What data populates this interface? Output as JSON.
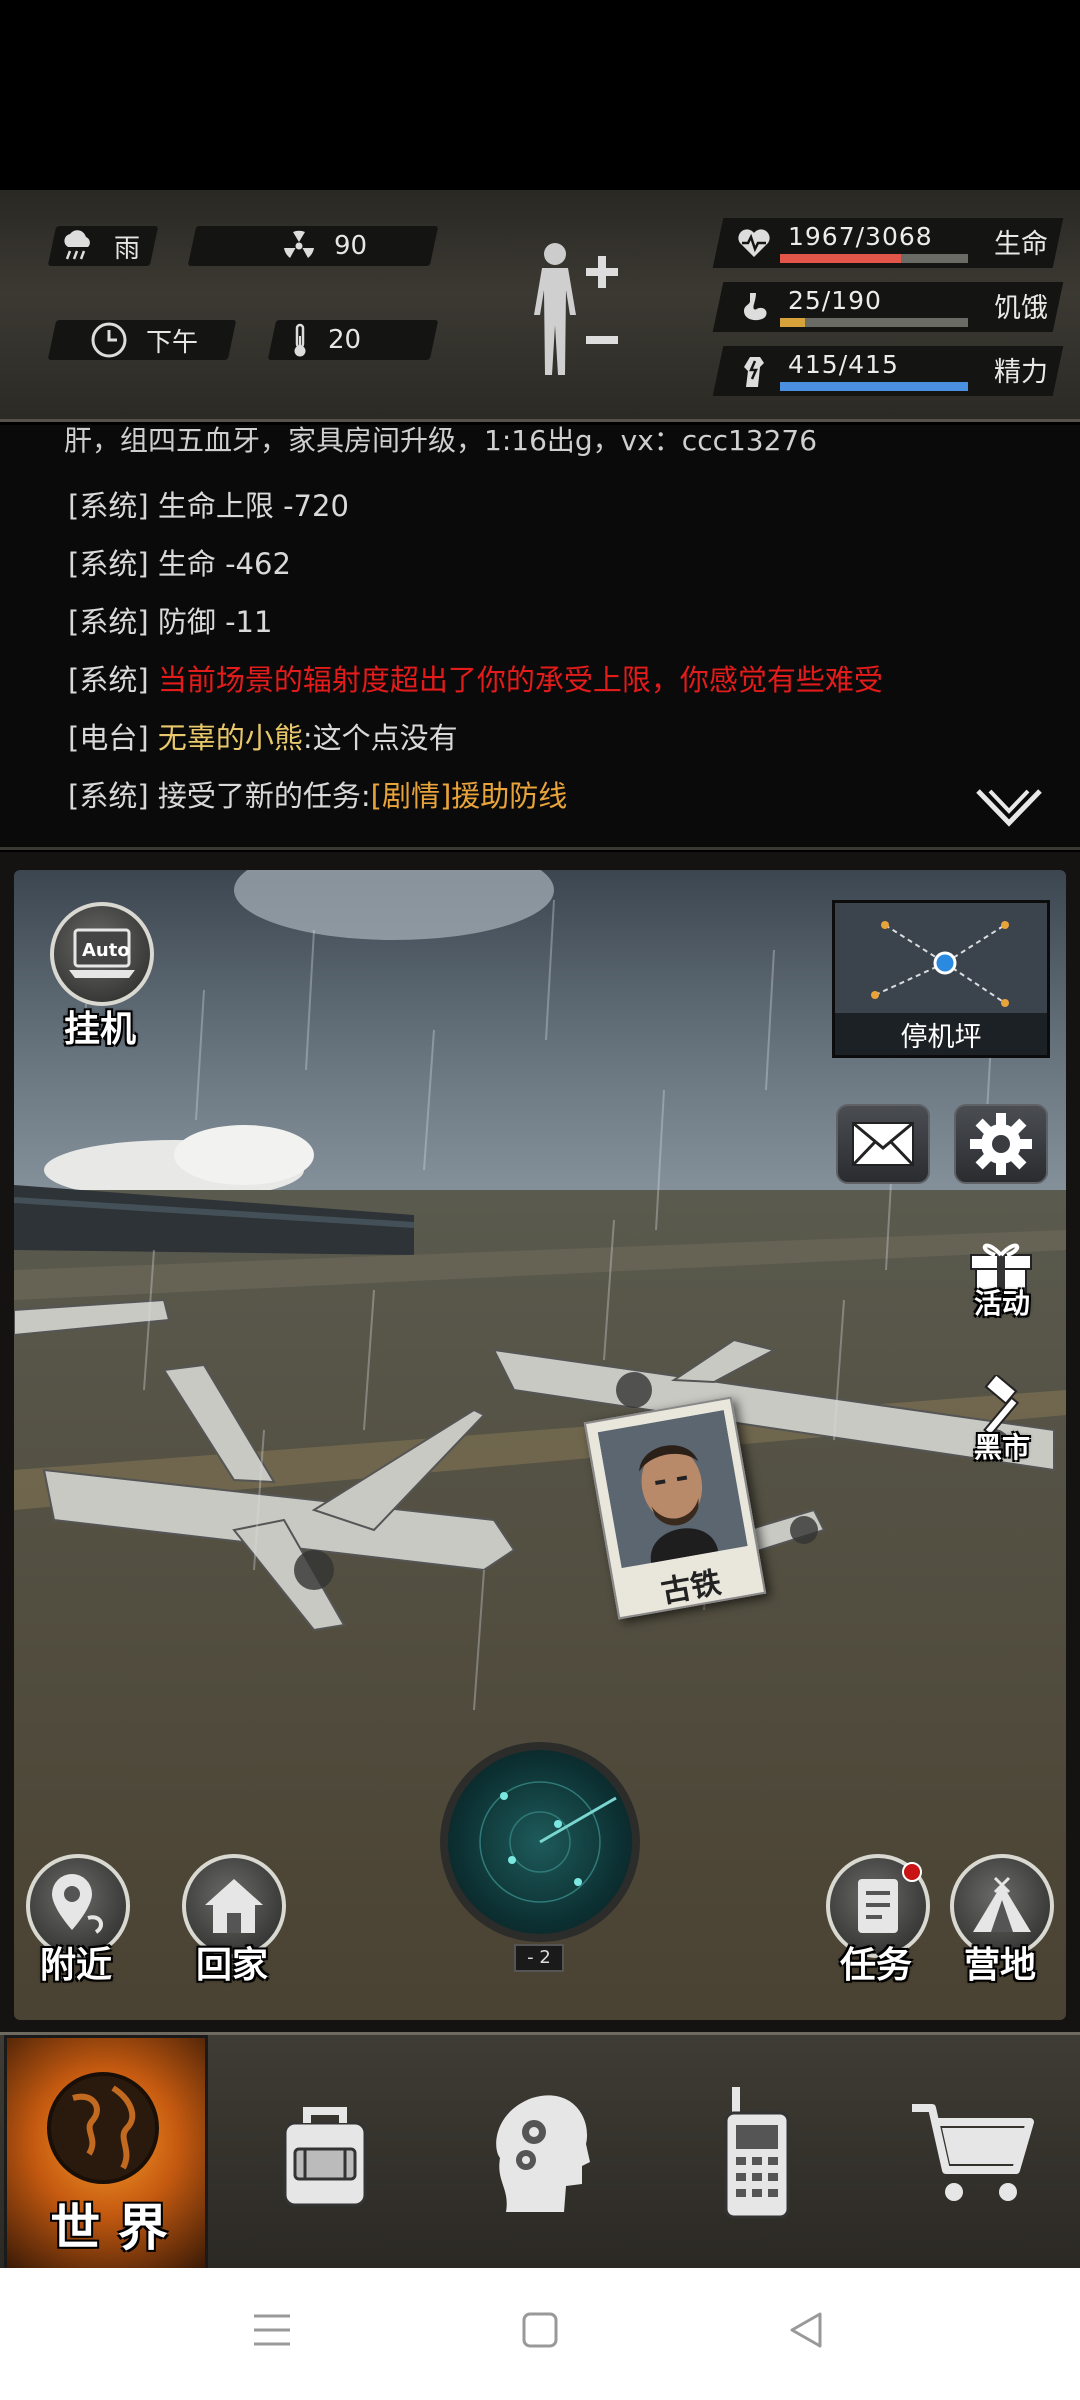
{
  "status": {
    "weather": "雨",
    "radiation": "90",
    "time_of_day": "下午",
    "temperature": "20",
    "health": {
      "text": "1967/3068",
      "label": "生命",
      "fraction": 0.641,
      "color": "#e2564a"
    },
    "hunger": {
      "text": "25/190",
      "label": "饥饿",
      "fraction": 0.132,
      "color": "#d7a23a"
    },
    "energy": {
      "text": "415/415",
      "label": "精力",
      "fraction": 1.0,
      "color": "#4a8fe0"
    }
  },
  "log": {
    "lines": [
      {
        "tag": "",
        "text": "肝，组四五血牙，家具房间升级，1:16出g，vx：ccc13276",
        "extra": ""
      },
      {
        "tag": "[系统]",
        "text": "生命上限 -720",
        "extra": ""
      },
      {
        "tag": "[系统]",
        "text": "生命 -462",
        "extra": ""
      },
      {
        "tag": "[系统]",
        "text": "防御 -11",
        "extra": ""
      },
      {
        "tag": "[系统]",
        "text": "当前场景的辐射度超出了你的承受上限，你感觉有些难受",
        "extra": ""
      },
      {
        "tag": "[电台]",
        "text": "无辜的小熊",
        "extra": ":这个点没有"
      },
      {
        "tag": "[系统]",
        "text": "接受了新的任务:",
        "extra": "[剧情]援助防线"
      }
    ]
  },
  "scene": {
    "auto_button_text": "Auto",
    "auto_label": "挂机",
    "location_name": "停机坪",
    "activity_label": "活动",
    "black_market_label": "黑市",
    "npc_name": "古铁",
    "radar_level": "- 2",
    "nearby_label": "附近",
    "home_label": "回家",
    "quest_label": "任务",
    "camp_label": "营地"
  },
  "nav": {
    "world_label": "世 界"
  },
  "colors": {
    "accent_orange": "#f59a2a",
    "log_red": "#e41b1b",
    "log_yellow": "#e8c86a",
    "log_orange": "#e8a43a"
  }
}
